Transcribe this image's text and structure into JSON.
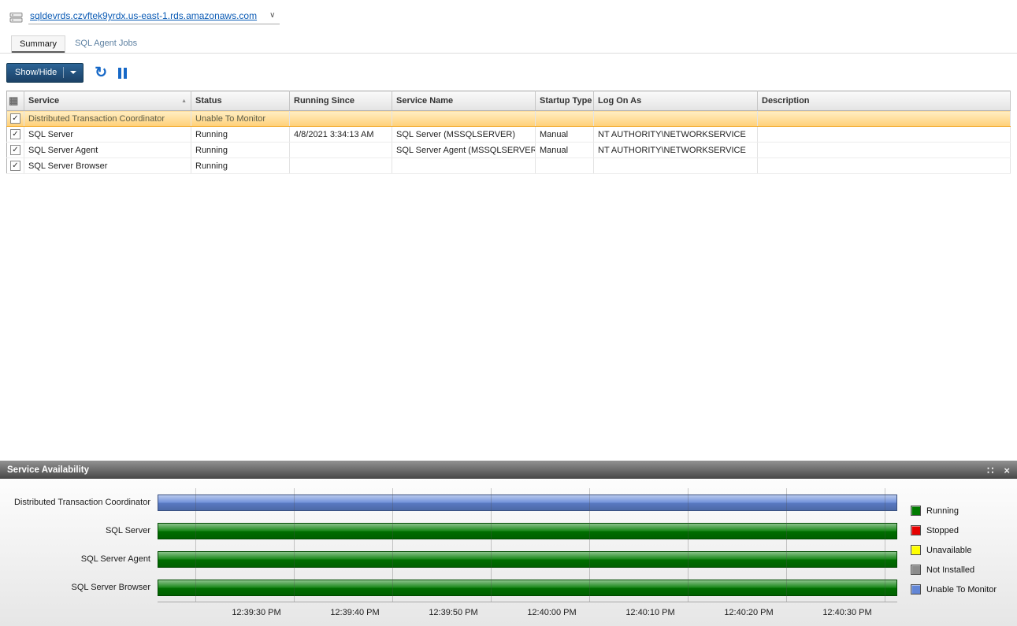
{
  "icons": {
    "chevron_down": "∨",
    "refresh": "↻",
    "check": "✓",
    "grid": "▦",
    "sort_asc": "▲",
    "dock": "∷",
    "close": "×"
  },
  "header": {
    "server": "sqldevrds.czvftek9yrdx.us-east-1.rds.amazonaws.com"
  },
  "tabs": [
    {
      "label": "Summary",
      "active": true
    },
    {
      "label": "SQL Agent Jobs",
      "active": false
    }
  ],
  "toolbar": {
    "show_hide_label": "Show/Hide"
  },
  "services_table": {
    "columns": [
      "Service",
      "Status",
      "Running Since",
      "Service Name",
      "Startup Type",
      "Log On As",
      "Description"
    ],
    "rows": [
      {
        "checked": true,
        "selected": true,
        "service": "Distributed Transaction Coordinator",
        "status": "Unable To Monitor",
        "running_since": "",
        "service_name": "",
        "startup_type": "",
        "log_on_as": "",
        "description": ""
      },
      {
        "checked": true,
        "selected": false,
        "service": "SQL Server",
        "status": "Running",
        "running_since": "4/8/2021 3:34:13 AM",
        "service_name": "SQL Server (MSSQLSERVER)",
        "startup_type": "Manual",
        "log_on_as": "NT AUTHORITY\\NETWORKSERVICE",
        "description": ""
      },
      {
        "checked": true,
        "selected": false,
        "service": "SQL Server Agent",
        "status": "Running",
        "running_since": "",
        "service_name": "SQL Server Agent (MSSQLSERVER)",
        "startup_type": "Manual",
        "log_on_as": "NT AUTHORITY\\NETWORKSERVICE",
        "description": ""
      },
      {
        "checked": true,
        "selected": false,
        "service": "SQL Server Browser",
        "status": "Running",
        "running_since": "",
        "service_name": "",
        "startup_type": "",
        "log_on_as": "",
        "description": ""
      }
    ]
  },
  "panel": {
    "title": "Service Availability"
  },
  "chart_data": {
    "type": "bar",
    "title": "Service Availability",
    "orientation": "horizontal-timeline",
    "categories": [
      "Distributed Transaction Coordinator",
      "SQL Server",
      "SQL Server Agent",
      "SQL Server Browser"
    ],
    "values": [
      "Unable To Monitor",
      "Running",
      "Running",
      "Running"
    ],
    "bar_colors": [
      "#6286d6",
      "#007a00",
      "#007a00",
      "#007a00"
    ],
    "x_ticks": [
      "12:39:30 PM",
      "12:39:40 PM",
      "12:39:50 PM",
      "12:40:00 PM",
      "12:40:10 PM",
      "12:40:20 PM",
      "12:40:30 PM"
    ],
    "legend": [
      {
        "label": "Running",
        "color": "#007a00"
      },
      {
        "label": "Stopped",
        "color": "#e60000"
      },
      {
        "label": "Unavailable",
        "color": "#ffff00"
      },
      {
        "label": "Not Installed",
        "color": "#8c8c8c"
      },
      {
        "label": "Unable To Monitor",
        "color": "#6286d6"
      }
    ]
  }
}
